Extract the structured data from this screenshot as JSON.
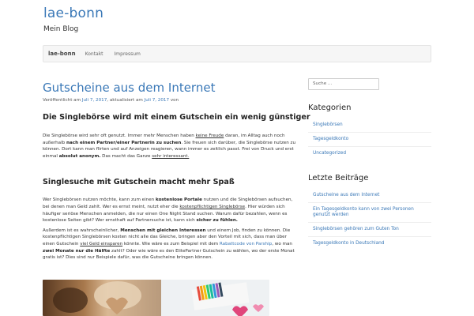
{
  "site": {
    "title": "lae-bonn",
    "description": "Mein Blog"
  },
  "nav": {
    "brand": "lae-bonn",
    "items": [
      "Kontakt",
      "Impressum"
    ]
  },
  "post": {
    "title": "Gutscheine aus dem Internet",
    "meta": {
      "published_prefix": "Veröffentlicht am ",
      "published_date": "Juli 7, 2017",
      "updated_prefix": ", aktualisiert am ",
      "updated_date": "Juli 7, 2017",
      "author_prefix": " von"
    },
    "heading1": "Die Singlebörse wird mit einem Gutschein ein wenig günstiger",
    "p1": {
      "t1": "Die Singlebörse wird sehr oft genutzt. Immer mehr Menschen haben ",
      "u1": "keine Freude",
      "t2": " daran, im Alltag auch noch außerhalb ",
      "b1": "nach einem Partner/einer Partnerin zu suchen",
      "t3": ". Sie freuen sich darüber, die Singlebörse nutzen zu können. Dort kann man flirten und auf Anzeigen reagieren, wann immer es zeitlich passt. Frei von Druck und erst einmal ",
      "b2": "absolut anonym.",
      "t4": " Das macht das Ganze ",
      "u2": "sehr interessant."
    },
    "heading2": "Singlesuche mit Gutschein macht mehr Spaß",
    "p2": {
      "t1": "Wer Singlebörsen nutzen möchte, kann zum einen ",
      "b1": "kostenlose Portale",
      "t2": " nutzen und die Singlebörsen aufsuchen, bei denen man Geld zahlt. Wer es ernst meint, nutzt eher die ",
      "u1": "kostenpflichtigen Singlebörse",
      "t3": ". Hier würden sich häufiger seriöse Menschen anmelden, die nur einen One Night Stand suchen. Warum dafür bezahlen, wenn es kostenlose Seiten gibt? Wer ernsthaft auf Partnersuche ist, kann sich ",
      "b2": "sicher zu fühlen."
    },
    "p3": {
      "t1": "Außerdem ist es wahrscheinlicher, ",
      "b1": "Menschen mit gleichen Interessen",
      "t2": " und einem Job, finden zu können. Die kostenpflichtigen Singlebörsen kosten nicht alle das Gleiche, bringen aber den Vorteil mit sich, dass man über einen Gutschein ",
      "u1": "viel Geld einsparen",
      "t3": " könnte. Wie wäre es zum Beispiel mit dem ",
      "l1": "Rabattcode von Parship",
      "t4": ", wo man ",
      "b2": "zwei Monate nur die Hälfte",
      "t5": " zahlt? Oder wie wäre es den ElitePartner Gutschein zu wählen, wo der erste Monat gratis ist? Dies sind nur Beispiele dafür, was die Gutscheine bringen können."
    }
  },
  "sidebar": {
    "search_placeholder": "Suche ...",
    "categories_title": "Kategorien",
    "categories": [
      "Singlebörsen",
      "Tagesgeldkonto",
      "Uncategorized"
    ],
    "recent_title": "Letzte Beiträge",
    "recent": [
      "Gutscheine aus dem Internet",
      "Ein Tagesgeldkonto kann von zwei Personen genutzt werden",
      "Singlebörsen gehören zum Guten Ton",
      "Tagesgeldkonto in Deutschland"
    ]
  },
  "colors": {
    "link": "#3a78b7",
    "text": "#333333",
    "navbar_bg": "#f6f6f6"
  }
}
